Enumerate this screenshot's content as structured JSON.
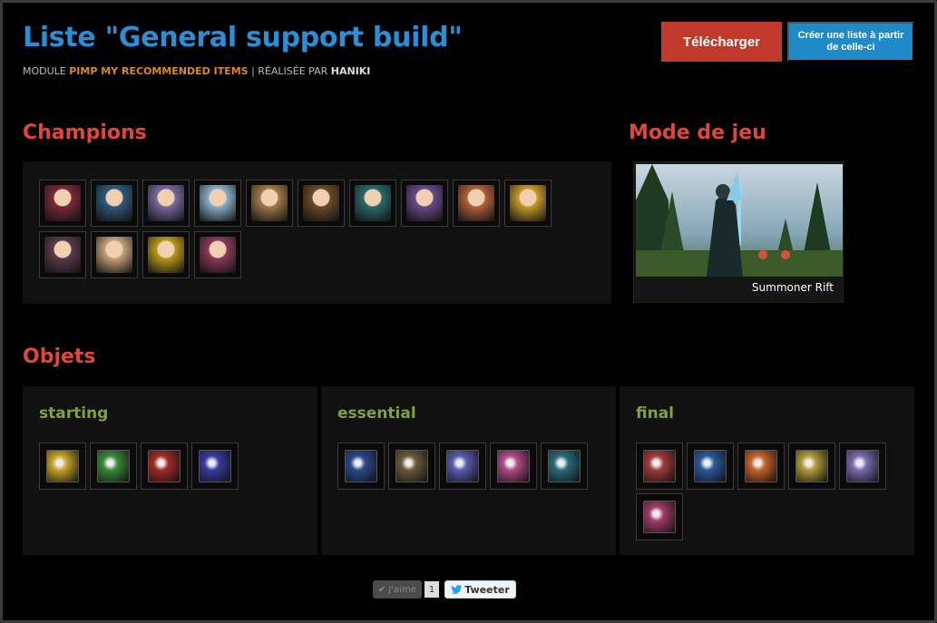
{
  "header": {
    "title": "Liste \"General support build\"",
    "prefix": "MODULE",
    "module_name": "PIMP MY RECOMMENDED ITEMS",
    "separator": "| RÉALISÉE PAR",
    "author": "HANIKI"
  },
  "actions": {
    "download_label": "Télécharger",
    "create_label": "Créer une liste à partir de celle-ci"
  },
  "sections": {
    "champions": "Champions",
    "game_mode": "Mode de jeu",
    "objects": "Objets"
  },
  "champions": [
    {
      "icon": "champion-portrait-1",
      "color": "#7a2a3a"
    },
    {
      "icon": "champion-portrait-2",
      "color": "#2f5a7a"
    },
    {
      "icon": "champion-portrait-3",
      "color": "#7a6aa0"
    },
    {
      "icon": "champion-portrait-4",
      "color": "#8ab0c8"
    },
    {
      "icon": "champion-portrait-5",
      "color": "#a07a4a"
    },
    {
      "icon": "champion-portrait-6",
      "color": "#6a4a2a"
    },
    {
      "icon": "champion-portrait-7",
      "color": "#2a6a6a"
    },
    {
      "icon": "champion-portrait-8",
      "color": "#6a4a8a"
    },
    {
      "icon": "champion-portrait-9",
      "color": "#b0623a"
    },
    {
      "icon": "champion-portrait-10",
      "color": "#c89a2a"
    },
    {
      "icon": "champion-portrait-11",
      "color": "#5a3a4a"
    },
    {
      "icon": "champion-portrait-12",
      "color": "#c8a27a"
    },
    {
      "icon": "champion-portrait-13",
      "color": "#b89a1a"
    },
    {
      "icon": "champion-portrait-14",
      "color": "#8a3a5a"
    }
  ],
  "game_mode": {
    "label": "Summoner Rift"
  },
  "item_groups": [
    {
      "name": "starting",
      "items": [
        {
          "icon": "item-gold-coin-icon",
          "color": "#c8a22a"
        },
        {
          "icon": "item-ward-icon",
          "color": "#3a8a3a"
        },
        {
          "icon": "item-red-vest-icon",
          "color": "#a02a2a"
        },
        {
          "icon": "item-potion-icon",
          "color": "#3a3aa0"
        }
      ]
    },
    {
      "name": "essential",
      "items": [
        {
          "icon": "item-blue-sword-icon",
          "color": "#2a4a8a"
        },
        {
          "icon": "item-boots-icon",
          "color": "#6a5a3a"
        },
        {
          "icon": "item-orb-icon",
          "color": "#5a5ab0"
        },
        {
          "icon": "item-pink-potion-icon",
          "color": "#b04a8a"
        },
        {
          "icon": "item-teal-eye-icon",
          "color": "#2a6a7a"
        }
      ]
    },
    {
      "name": "final",
      "items": [
        {
          "icon": "item-red-shield-icon",
          "color": "#a03a3a"
        },
        {
          "icon": "item-blue-swirl-icon",
          "color": "#2a5a9a"
        },
        {
          "icon": "item-fire-icon",
          "color": "#c8622a"
        },
        {
          "icon": "item-gold-shield-icon",
          "color": "#b09a3a"
        },
        {
          "icon": "item-crystal-icon",
          "color": "#7a6ab0"
        },
        {
          "icon": "item-pink-eye-icon",
          "color": "#a03a6a"
        }
      ]
    }
  ],
  "social": {
    "like_label": "J'aime",
    "like_count": "1",
    "tweet_label": "Tweeter"
  },
  "colors": {
    "title": "#2a8fd6",
    "section_heading": "#e0473a",
    "group_heading": "#7fa33a",
    "download_button": "#c0392b",
    "create_button": "#1f8ac6"
  }
}
